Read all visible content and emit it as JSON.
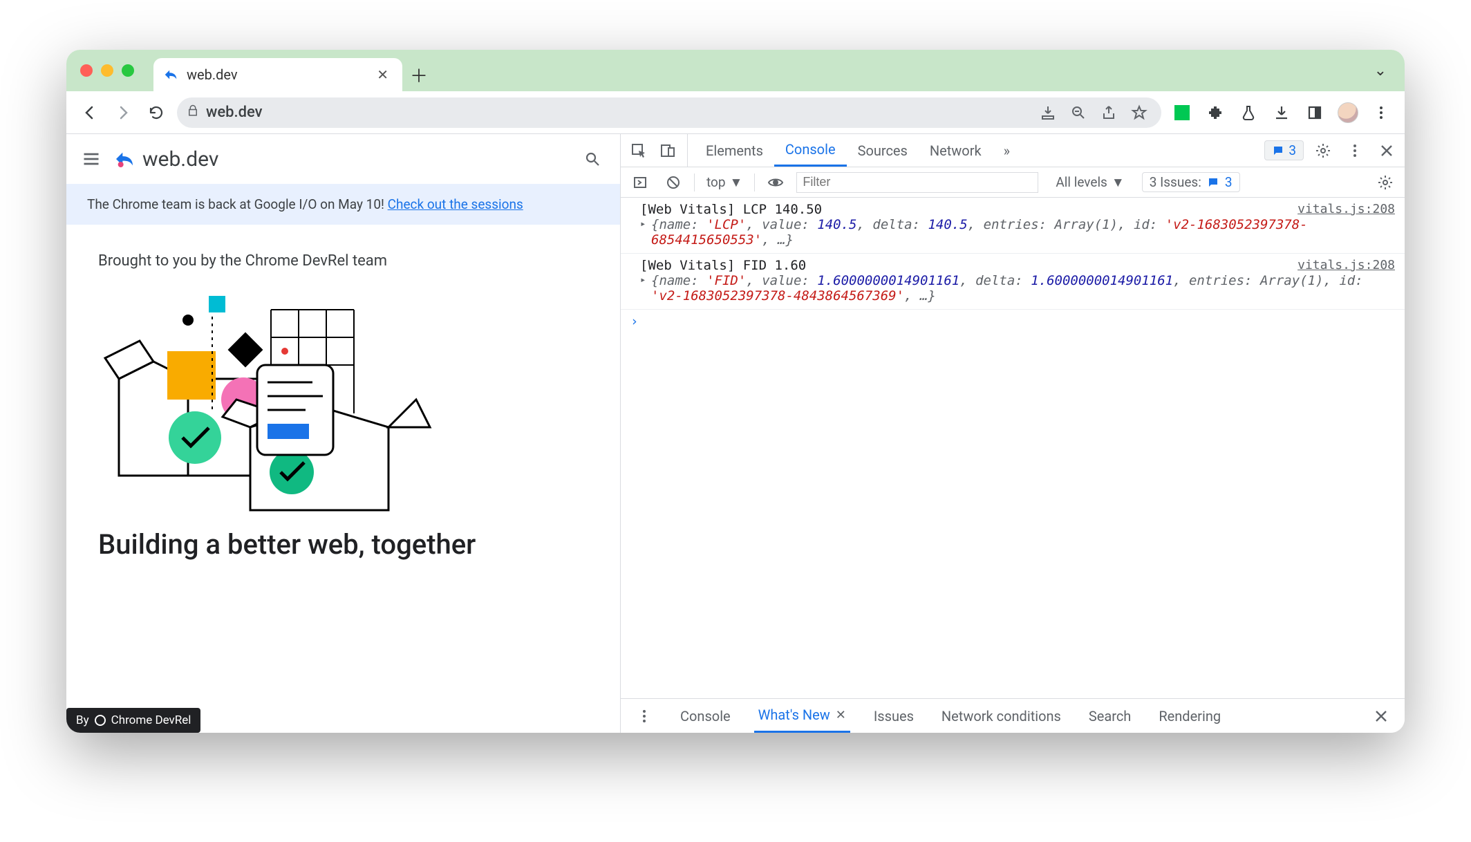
{
  "window": {
    "tab_title": "web.dev",
    "url_display": "web.dev"
  },
  "page": {
    "brand": "web.dev",
    "banner_text": "The Chrome team is back at Google I/O on May 10! ",
    "banner_link": "Check out the sessions",
    "byline": "Brought to you by the Chrome DevRel team",
    "headline": "Building a better web, together",
    "badge_prefix": "By",
    "badge_label": "Chrome DevRel"
  },
  "devtools": {
    "tabs": [
      "Elements",
      "Console",
      "Sources",
      "Network"
    ],
    "active_tab": "Console",
    "overflow": "»",
    "messages_badge": "3",
    "subbar": {
      "context": "top",
      "filter_placeholder": "Filter",
      "levels": "All levels",
      "issues_label": "3 Issues:",
      "issues_count": "3"
    },
    "logs": [
      {
        "head": "[Web Vitals] LCP 140.50",
        "src": "vitals.js:208",
        "obj_html": "{<span class='k'>name:</span> <span class='s'>'LCP'</span>, <span class='k'>value:</span> <span class='n'>140.5</span>, <span class='k'>delta:</span> <span class='n'>140.5</span>, <span class='k'>entries:</span> Array(1), <span class='k'>id:</span> <span class='s'>'v2-1683052397378-6854415650553'</span>, …}"
      },
      {
        "head": "[Web Vitals] FID 1.60",
        "src": "vitals.js:208",
        "obj_html": "{<span class='k'>name:</span> <span class='s'>'FID'</span>, <span class='k'>value:</span> <span class='n'>1.6000000014901161</span>, <span class='k'>delta:</span> <span class='n'>1.6000000014901161</span>, <span class='k'>entries:</span> Array(1), <span class='k'>id:</span> <span class='s'>'v2-1683052397378-4843864567369'</span>, …}"
      }
    ],
    "drawer": {
      "tabs": [
        "Console",
        "What's New",
        "Issues",
        "Network conditions",
        "Search",
        "Rendering"
      ],
      "active": "What's New"
    }
  }
}
